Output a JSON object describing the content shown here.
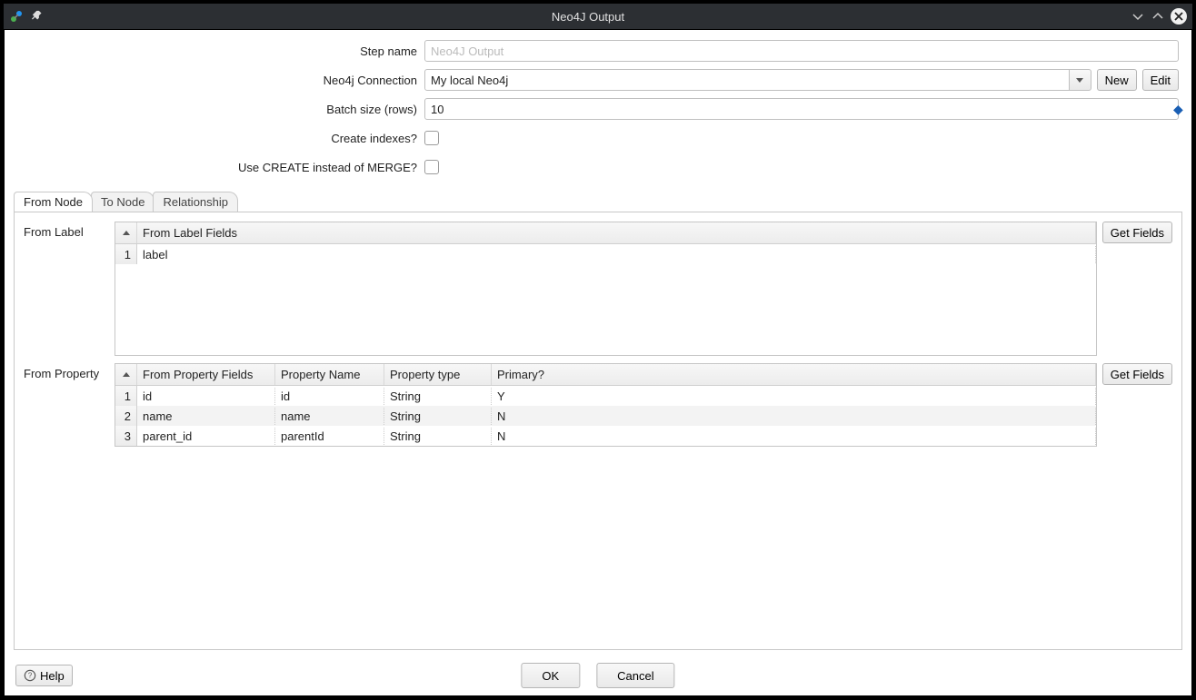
{
  "window": {
    "title": "Neo4J Output"
  },
  "form": {
    "step_name": {
      "label": "Step name",
      "placeholder": "Neo4J Output",
      "value": ""
    },
    "connection": {
      "label": "Neo4j Connection",
      "value": "My local Neo4j",
      "new_btn": "New",
      "edit_btn": "Edit"
    },
    "batch_size": {
      "label": "Batch size (rows)",
      "value": "10"
    },
    "create_indexes": {
      "label": "Create indexes?",
      "checked": false
    },
    "use_create": {
      "label": "Use CREATE instead of MERGE?",
      "checked": false
    }
  },
  "tabs": {
    "from_node": "From Node",
    "to_node": "To Node",
    "relationship": "Relationship",
    "active": "from_node"
  },
  "from_label_section": {
    "label": "From Label",
    "header": "From Label Fields",
    "get_fields_btn": "Get Fields",
    "rows": [
      {
        "n": "1",
        "field": "label"
      }
    ]
  },
  "from_property_section": {
    "label": "From Property",
    "get_fields_btn": "Get Fields",
    "headers": {
      "c1": "From Property Fields",
      "c2": "Property Name",
      "c3": "Property type",
      "c4": "Primary?"
    },
    "rows": [
      {
        "n": "1",
        "field": "id",
        "name": "id",
        "type": "String",
        "primary": "Y"
      },
      {
        "n": "2",
        "field": "name",
        "name": "name",
        "type": "String",
        "primary": "N"
      },
      {
        "n": "3",
        "field": "parent_id",
        "name": "parentId",
        "type": "String",
        "primary": "N"
      }
    ]
  },
  "footer": {
    "help": "Help",
    "ok": "OK",
    "cancel": "Cancel"
  }
}
